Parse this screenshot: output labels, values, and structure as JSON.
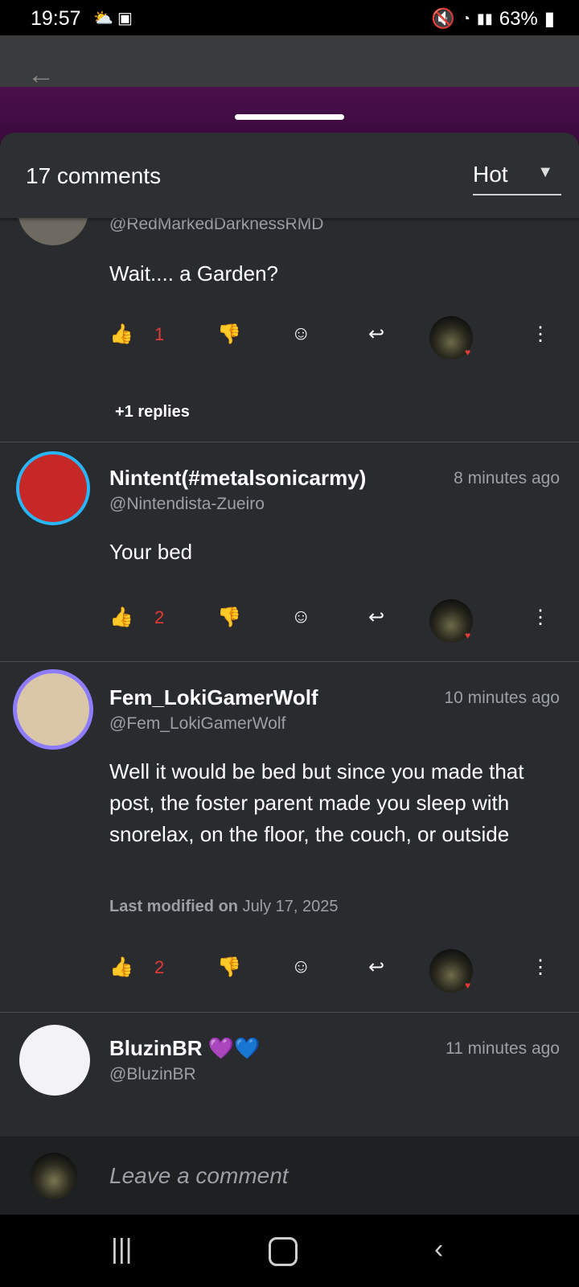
{
  "status": {
    "time": "19:57",
    "battery": "63%"
  },
  "sheet": {
    "count_label": "17 comments",
    "sort_label": "Hot"
  },
  "comments": [
    {
      "handle": "@RedMarkedDarknessRMD",
      "body": "Wait.... a Garden?",
      "likes": "1",
      "replies": "+1 replies"
    },
    {
      "username": "Nintent(#metalsonicarmy)",
      "handle": "@Nintendista-Zueiro",
      "time": "8 minutes ago",
      "body": "Your bed",
      "likes": "2"
    },
    {
      "username": "Fem_LokiGamerWolf",
      "handle": "@Fem_LokiGamerWolf",
      "time": "10 minutes ago",
      "body": "Well it would be bed but since you made that post, the foster parent made you sleep with snorelax, on the floor, the couch, or outside",
      "modified_prefix": "Last modified on",
      "modified_date": "July 17, 2025",
      "likes": "2"
    },
    {
      "username": "BluzinBR 💜💙",
      "handle": "@BluzinBR",
      "time": "11 minutes ago"
    }
  ],
  "composer": {
    "placeholder": "Leave a comment"
  },
  "icons": {
    "like": "thumb-up-icon",
    "dislike": "thumb-down-icon",
    "react": "add-emoji-icon",
    "reply": "reply-icon",
    "more": "more-vertical-icon"
  },
  "colors": {
    "accent": "#e53935",
    "sheet": "#292b2e"
  }
}
